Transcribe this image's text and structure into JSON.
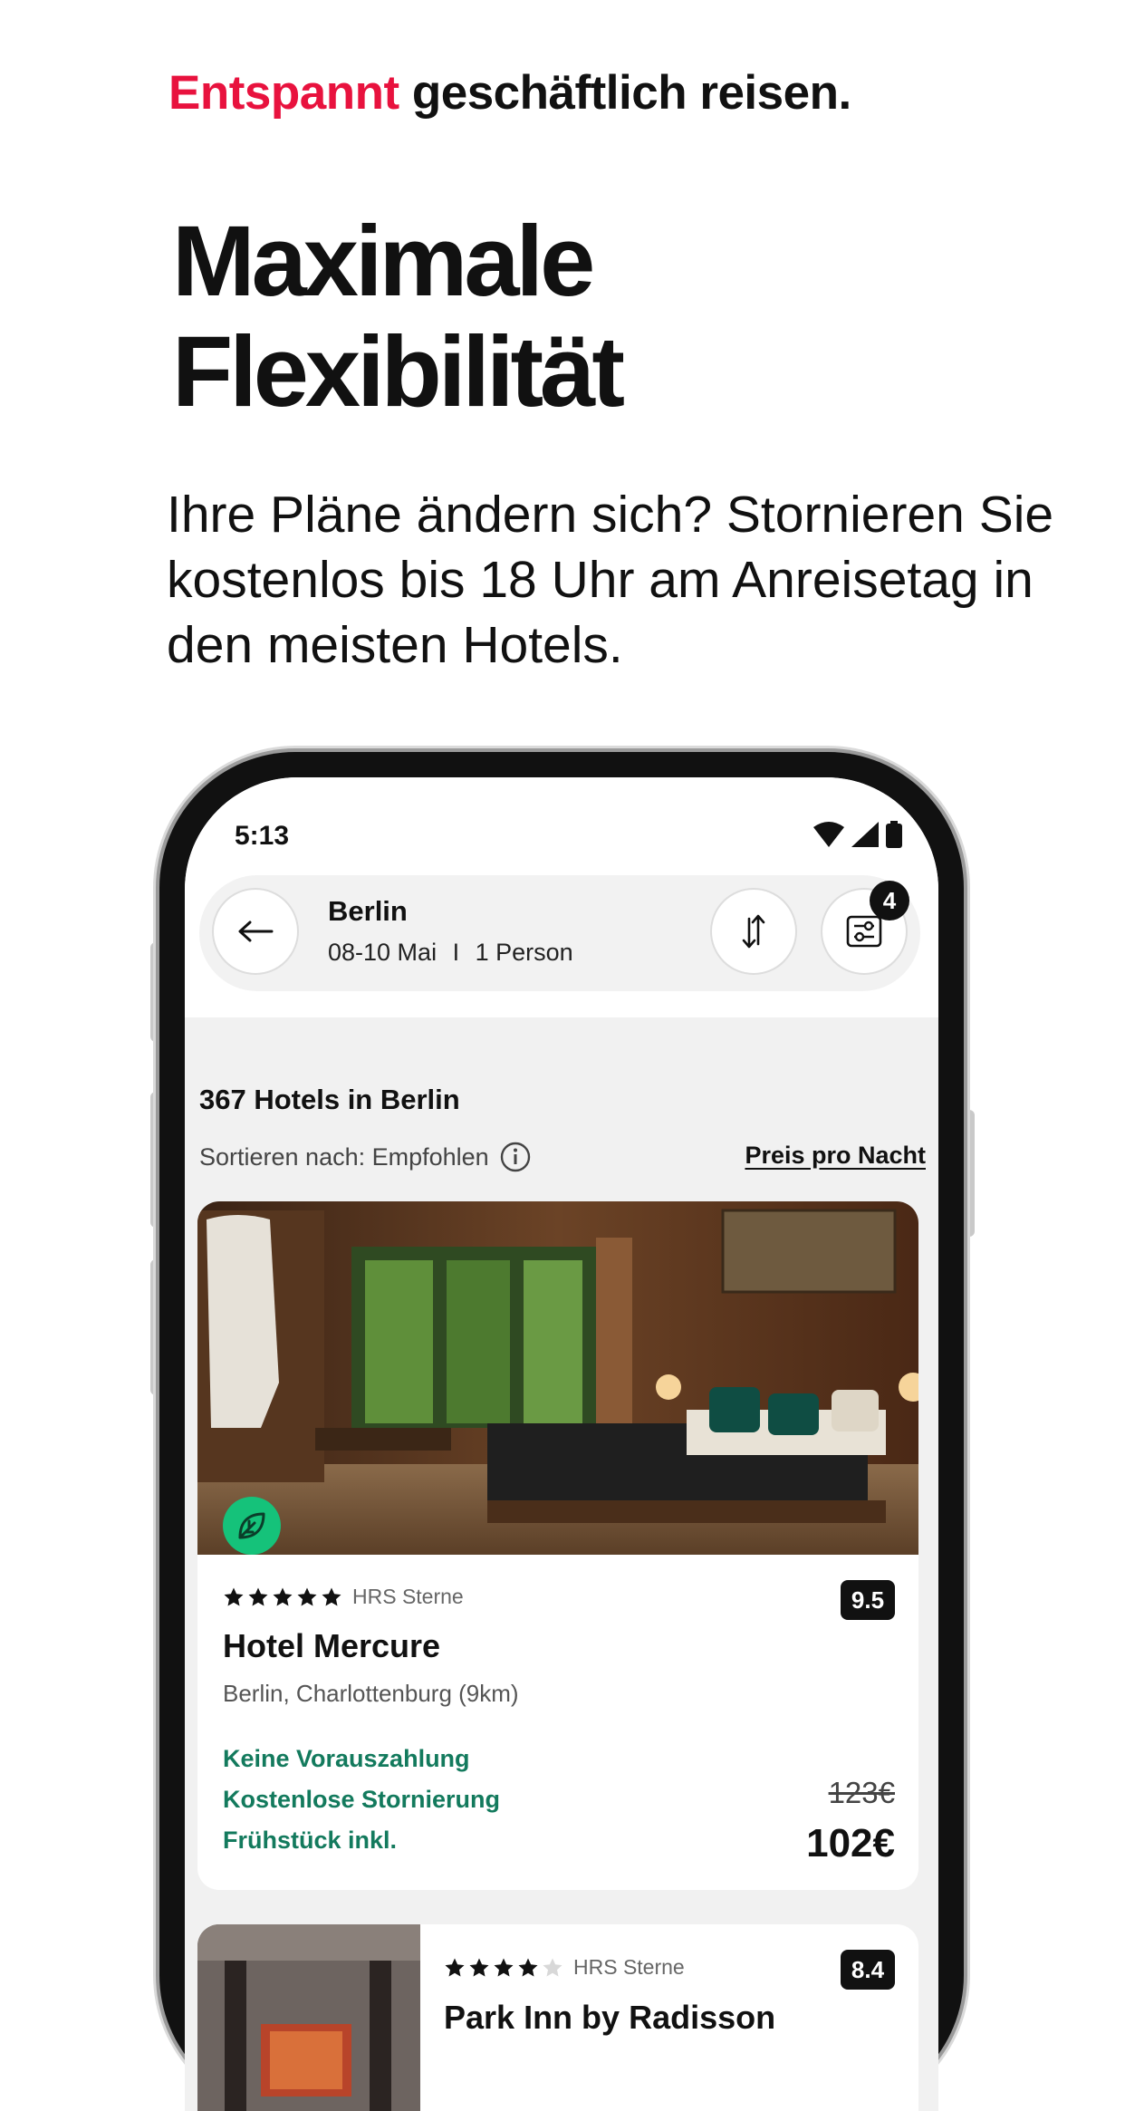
{
  "promo": {
    "tagline_accent": "Entspannt",
    "tagline_rest": "geschäftlich reisen.",
    "headline_line1": "Maximale",
    "headline_line2": "Flexibilität",
    "subtext": "Ihre Pläne ändern sich? Stornieren Sie kostenlos bis 18 Uhr am Anreisetag in den meisten Hotels."
  },
  "status_bar": {
    "time": "5:13",
    "icons": [
      "wifi-icon",
      "signal-icon",
      "battery-icon"
    ]
  },
  "search": {
    "city": "Berlin",
    "dates": "08-10 Mai",
    "separator": "I",
    "guests": "1 Person",
    "filter_count": "4",
    "icons": [
      "back-arrow-icon",
      "sort-icon",
      "filter-icon"
    ]
  },
  "results": {
    "count_label": "367 Hotels in Berlin",
    "sort_label": "Sortieren nach: Empfohlen",
    "price_mode": "Preis pro Nacht"
  },
  "hotels": [
    {
      "stars": 5,
      "stars_label": "HRS Sterne",
      "score": "9.5",
      "name": "Hotel Mercure",
      "location": "Berlin, Charlottenburg (9km)",
      "benefits": [
        "Keine Vorauszahlung",
        "Kostenlose Stornierung",
        "Frühstück inkl."
      ],
      "old_price": "123€",
      "price": "102€",
      "eco_badge": "leaf-icon"
    },
    {
      "stars": 4,
      "stars_label": "HRS Sterne",
      "score": "8.4",
      "name": "Park Inn by Radisson"
    }
  ],
  "colors": {
    "accent": "#e8123e",
    "benefit_green": "#137a5d",
    "eco_green": "#15c27a"
  }
}
